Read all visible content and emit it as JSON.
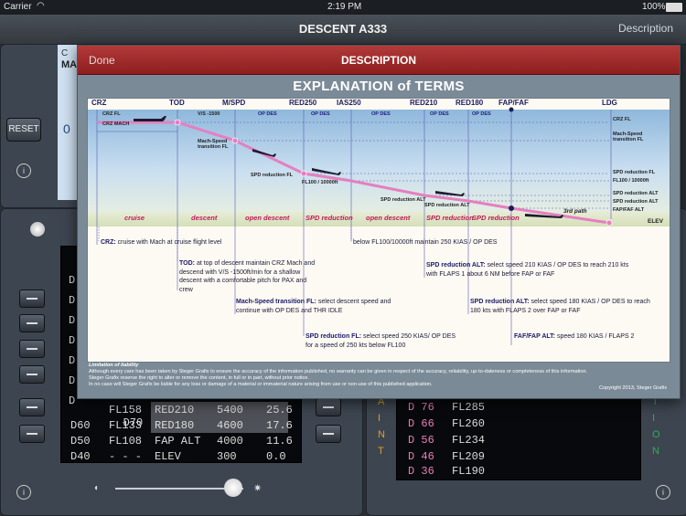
{
  "status_bar": {
    "carrier": "Carrier",
    "time": "2:19 PM",
    "battery": "100%"
  },
  "nav": {
    "title": "DESCENT A333",
    "right_button": "Description"
  },
  "left_panel": {
    "reset_label": "RESET",
    "top_partial": "C",
    "ma_partial": "MA",
    "zero_partial": "0"
  },
  "fmc_rows": [
    {
      "d": "D70",
      "fl": "FL158",
      "name": "RED210",
      "alt": "5400",
      "dist": "25.6"
    },
    {
      "d": "D60",
      "fl": "FL133",
      "name": "RED180",
      "alt": "4600",
      "dist": "17.6"
    },
    {
      "d": "D50",
      "fl": "FL108",
      "name": "FAP ALT",
      "alt": "4000",
      "dist": "11.6"
    },
    {
      "d": "D40",
      "fl": "- - -",
      "name": "ELEV",
      "alt": "300",
      "dist": "0.0"
    }
  ],
  "left_dcol": [
    "D",
    "D",
    "D",
    "D",
    "D",
    "D",
    "D"
  ],
  "right_rows": [
    {
      "d": "D 76",
      "fl": "FL285"
    },
    {
      "d": "D 66",
      "fl": "FL260"
    },
    {
      "d": "D 56",
      "fl": "FL234"
    },
    {
      "d": "D 46",
      "fl": "FL209"
    },
    {
      "d": "D 36",
      "fl": "FL190"
    }
  ],
  "right_side_letters_left": [
    "A",
    "I",
    "N",
    "T"
  ],
  "right_side_letters_right": [
    "T",
    "I",
    "O",
    "N"
  ],
  "modal": {
    "done": "Done",
    "title": "DESCRIPTION",
    "heading": "EXPLANATION of TERMS"
  },
  "chart": {
    "waypoints": [
      "CRZ",
      "TOD",
      "M/SPD",
      "RED250",
      "IAS250",
      "RED210",
      "RED180",
      "FAP/FAF",
      "LDG"
    ],
    "phases": [
      "cruise",
      "descent",
      "open descent",
      "SPD reduction",
      "open descent",
      "SPD reduction",
      "SPD reduction"
    ],
    "top_labels": {
      "crz_fl": "CRZ FL",
      "crz_mach": "CRZ MACH",
      "vs": "V/S -1500",
      "op_des": "OP DES",
      "third_path": "3rd path"
    },
    "inner_labels": {
      "mach_speed": "Mach-Speed transition FL",
      "spd_red_fl": "SPD reduction FL",
      "fl100": "FL100 / 10000ft",
      "spd_red_alt": "SPD reduction ALT"
    },
    "right_labels": [
      "CRZ FL",
      "Mach-Speed transition FL",
      "SPD reduction FL",
      "FL100 / 10000ft",
      "SPD reduction ALT",
      "SPD reduction ALT",
      "FAP/FAF ALT",
      "ELEV"
    ]
  },
  "notes": {
    "crz": {
      "key": "CRZ:",
      "text": "cruise with Mach at cruise flight level"
    },
    "tod": {
      "key": "TOD:",
      "text": "at top of descent maintain CRZ Mach and descend with V/S -1500ft/min for a shallow descent with a comfortable pitch for PAX and crew"
    },
    "mach": {
      "key": "Mach-Speed transition FL:",
      "text": "select descent speed and continue with OP DES and THR IDLE"
    },
    "spdfl": {
      "key": "SPD reduction FL:",
      "text": "select speed 250 KIAS/ OP DES for a speed of 250 kts below FL100"
    },
    "below": {
      "text": "below FL100/10000ft maintain 250 KIAS / OP DES"
    },
    "alt1": {
      "key": "SPD reduction ALT:",
      "text": "select speed 210 KIAS / OP DES to reach 210 kts with FLAPS 1 about 6 NM before FAP or FAF"
    },
    "alt2": {
      "key": "SPD reduction ALT:",
      "text": "select speed 180 KIAS / OP DES to reach 180 kts with FLAPS 2 over FAP or FAF"
    },
    "faf": {
      "key": "FAF/FAP ALT:",
      "text": "speed 180 KIAS / FLAPS 2"
    }
  },
  "liability": {
    "title": "Limitation of liability",
    "line1": "Although every care has been taken by Steger Grafix to ensure the accuracy of the information published, no warranty can be given in respect of the accuracy, reliability, up-to-dateness or completeness of this information.",
    "line2": "Steger Grafix reserve the right to alter or remove the content, in full or in part, without prior notice.",
    "line3": "In no case will Steger Grafix be liable for any loss or damage of a material or immaterial nature arising from use or non-use of this published application.",
    "copyright": "Copyright 2013, Steger Grafix"
  },
  "colors": {
    "modal_header": "#a22a2a",
    "phase_text": "#c2185b",
    "profile_line": "#e57fc0",
    "waypoint_text": "#1b1b5e"
  }
}
